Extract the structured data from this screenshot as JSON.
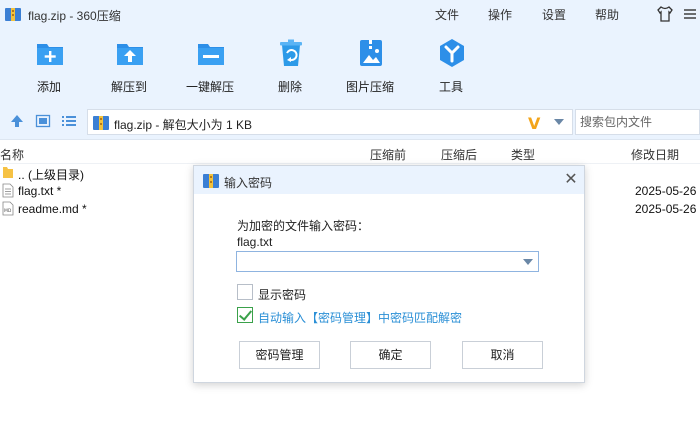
{
  "window": {
    "title": "flag.zip - 360压缩"
  },
  "menu": {
    "file": "文件",
    "ops": "操作",
    "settings": "设置",
    "help": "帮助"
  },
  "toolbar": [
    {
      "label": "添加",
      "icon": "add-icon"
    },
    {
      "label": "解压到",
      "icon": "extract-to-icon"
    },
    {
      "label": "一键解压",
      "icon": "one-click-extract-icon"
    },
    {
      "label": "删除",
      "icon": "delete-icon"
    },
    {
      "label": "图片压缩",
      "icon": "image-compress-icon"
    },
    {
      "label": "工具",
      "icon": "tools-icon"
    }
  ],
  "address": {
    "path": "flag.zip - 解包大小为 1 KB",
    "search_placeholder": "搜索包内文件"
  },
  "list": {
    "columns": {
      "name": "名称",
      "compressed_before": "压缩前",
      "compressed_after": "压缩后",
      "type": "类型",
      "modified": "修改日期"
    },
    "rows": [
      {
        "name": ".. (上级目录)",
        "date": "",
        "icon": "folder-icon"
      },
      {
        "name": "flag.txt *",
        "date": "2025-05-26",
        "icon": "text-file-icon"
      },
      {
        "name": "readme.md *",
        "date": "2025-05-26",
        "icon": "md-file-icon"
      }
    ]
  },
  "dialog": {
    "title": "输入密码",
    "prompt": "为加密的文件输入密码：",
    "filename": "flag.txt",
    "password_value": "",
    "show_password_label": "显示密码",
    "show_password_checked": false,
    "auto_input_label": "自动输入【密码管理】中密码匹配解密",
    "auto_input_checked": true,
    "buttons": {
      "manage": "密码管理",
      "ok": "确定",
      "cancel": "取消"
    }
  }
}
